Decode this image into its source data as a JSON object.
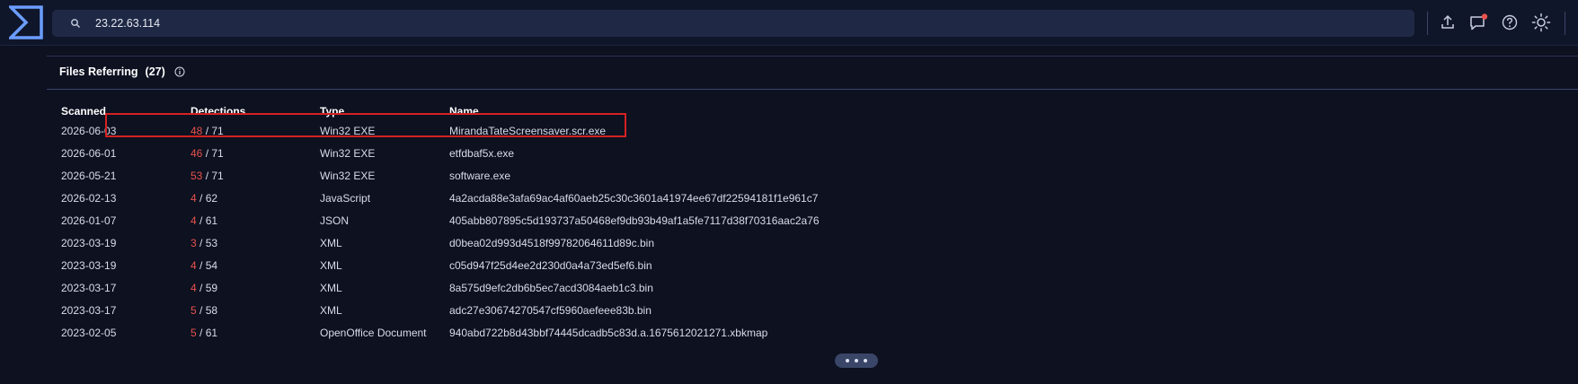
{
  "search": {
    "value": "23.22.63.114",
    "placeholder": ""
  },
  "toolbar": {
    "icons": [
      "upload-icon",
      "notifications-icon",
      "help-icon",
      "theme-icon"
    ],
    "notification_dot_color": "#e8524c"
  },
  "files_referring": {
    "title": "Files Referring",
    "count": "(27)",
    "columns": [
      "Scanned",
      "Detections",
      "Type",
      "Name"
    ],
    "rows": [
      {
        "scanned": "2026-06-03",
        "detections": "48",
        "total": " / 71",
        "type": "Win32 EXE",
        "name": "MirandaTateScreensaver.scr.exe"
      },
      {
        "scanned": "2026-06-01",
        "detections": "46",
        "total": " / 71",
        "type": "Win32 EXE",
        "name": "etfdbaf5x.exe"
      },
      {
        "scanned": "2026-05-21",
        "detections": "53",
        "total": " / 71",
        "type": "Win32 EXE",
        "name": "software.exe"
      },
      {
        "scanned": "2026-02-13",
        "detections": "4",
        "total": " / 62",
        "type": "JavaScript",
        "name": "4a2acda88e3afa69ac4af60aeb25c30c3601a41974ee67df22594181f1e961c7"
      },
      {
        "scanned": "2026-01-07",
        "detections": "4",
        "total": " / 61",
        "type": "JSON",
        "name": "405abb807895c5d193737a50468ef9db93b49af1a5fe7117d38f70316aac2a76"
      },
      {
        "scanned": "2023-03-19",
        "detections": "3",
        "total": " / 53",
        "type": "XML",
        "name": "d0bea02d993d4518f99782064611d89c.bin"
      },
      {
        "scanned": "2023-03-19",
        "detections": "4",
        "total": " / 54",
        "type": "XML",
        "name": "c05d947f25d4ee2d230d0a4a73ed5ef6.bin"
      },
      {
        "scanned": "2023-03-17",
        "detections": "4",
        "total": " / 59",
        "type": "XML",
        "name": "8a575d9efc2db6b5ec7acd3084aeb1c3.bin"
      },
      {
        "scanned": "2023-03-17",
        "detections": "5",
        "total": " / 58",
        "type": "XML",
        "name": "adc27e30674270547cf5960aefeee83b.bin"
      },
      {
        "scanned": "2023-02-05",
        "detections": "5",
        "total": " / 61",
        "type": "OpenOffice Document",
        "name": "940abd722b8d43bbf74445dcadb5c83d.a.1675612021271.xbkmap"
      }
    ],
    "highlighted_row": 0,
    "highlight_color": "#d42222",
    "positive_color": "#e8524c"
  }
}
